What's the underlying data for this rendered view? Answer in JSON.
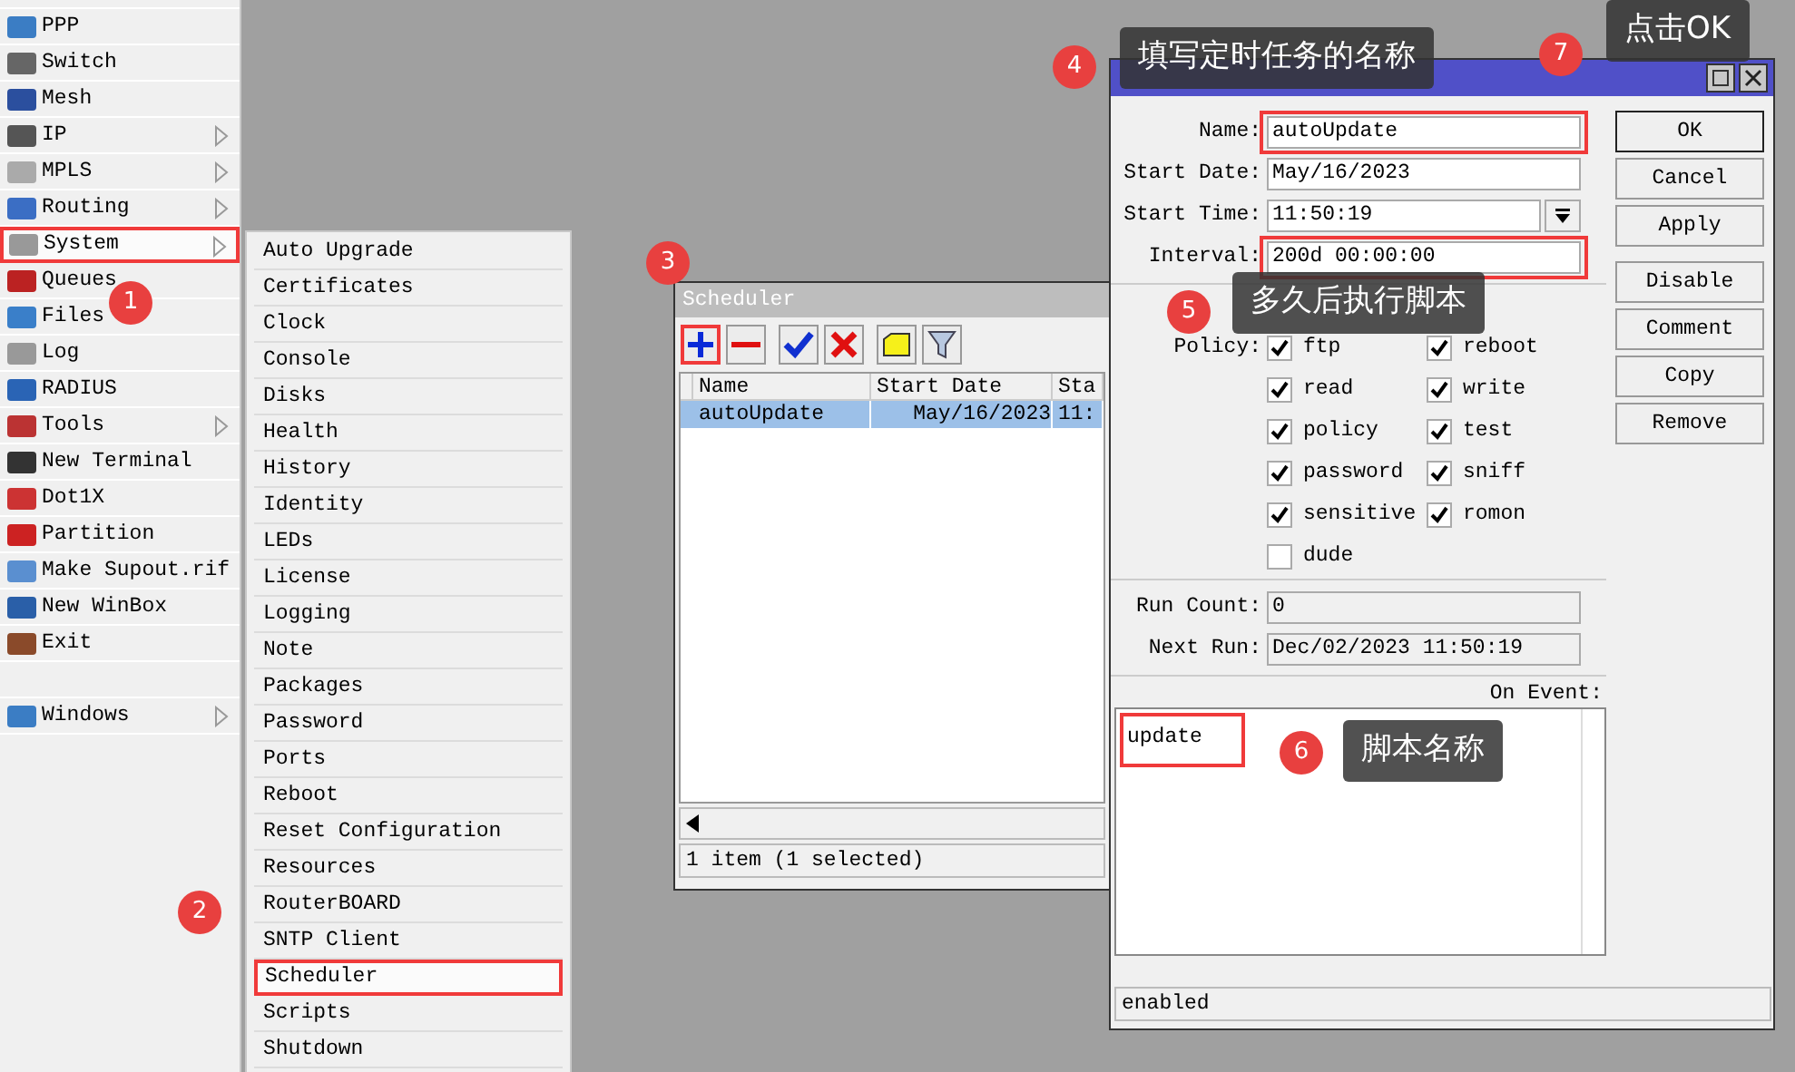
{
  "main_menu": {
    "items": [
      {
        "label": "PPP",
        "has_submenu": false,
        "selected": false,
        "highlighted": false
      },
      {
        "label": "Switch",
        "has_submenu": false,
        "selected": false,
        "highlighted": false
      },
      {
        "label": "Mesh",
        "has_submenu": false,
        "selected": false,
        "highlighted": false
      },
      {
        "label": "IP",
        "has_submenu": true,
        "selected": false,
        "highlighted": false
      },
      {
        "label": "MPLS",
        "has_submenu": true,
        "selected": false,
        "highlighted": false
      },
      {
        "label": "Routing",
        "has_submenu": true,
        "selected": false,
        "highlighted": false
      },
      {
        "label": "System",
        "has_submenu": true,
        "selected": true,
        "highlighted": true
      },
      {
        "label": "Queues",
        "has_submenu": false,
        "selected": false,
        "highlighted": false
      },
      {
        "label": "Files",
        "has_submenu": false,
        "selected": false,
        "highlighted": false
      },
      {
        "label": "Log",
        "has_submenu": false,
        "selected": false,
        "highlighted": false
      },
      {
        "label": "RADIUS",
        "has_submenu": false,
        "selected": false,
        "highlighted": false
      },
      {
        "label": "Tools",
        "has_submenu": true,
        "selected": false,
        "highlighted": false
      },
      {
        "label": "New Terminal",
        "has_submenu": false,
        "selected": false,
        "highlighted": false
      },
      {
        "label": "Dot1X",
        "has_submenu": false,
        "selected": false,
        "highlighted": false
      },
      {
        "label": "Partition",
        "has_submenu": false,
        "selected": false,
        "highlighted": false
      },
      {
        "label": "Make Supout.rif",
        "has_submenu": false,
        "selected": false,
        "highlighted": false
      },
      {
        "label": "New WinBox",
        "has_submenu": false,
        "selected": false,
        "highlighted": false
      },
      {
        "label": "Exit",
        "has_submenu": false,
        "selected": false,
        "highlighted": false
      }
    ],
    "bottom_items": [
      {
        "label": "Windows",
        "has_submenu": true,
        "selected": false,
        "highlighted": false
      }
    ]
  },
  "system_submenu": {
    "items": [
      {
        "label": "Auto Upgrade",
        "selected": false,
        "highlighted": false
      },
      {
        "label": "Certificates",
        "selected": false,
        "highlighted": false
      },
      {
        "label": "Clock",
        "selected": false,
        "highlighted": false
      },
      {
        "label": "Console",
        "selected": false,
        "highlighted": false
      },
      {
        "label": "Disks",
        "selected": false,
        "highlighted": false
      },
      {
        "label": "Health",
        "selected": false,
        "highlighted": false
      },
      {
        "label": "History",
        "selected": false,
        "highlighted": false
      },
      {
        "label": "Identity",
        "selected": false,
        "highlighted": false
      },
      {
        "label": "LEDs",
        "selected": false,
        "highlighted": false
      },
      {
        "label": "License",
        "selected": false,
        "highlighted": false
      },
      {
        "label": "Logging",
        "selected": false,
        "highlighted": false
      },
      {
        "label": "Note",
        "selected": false,
        "highlighted": false
      },
      {
        "label": "Packages",
        "selected": false,
        "highlighted": false
      },
      {
        "label": "Password",
        "selected": false,
        "highlighted": false
      },
      {
        "label": "Ports",
        "selected": false,
        "highlighted": false
      },
      {
        "label": "Reboot",
        "selected": false,
        "highlighted": false
      },
      {
        "label": "Reset Configuration",
        "selected": false,
        "highlighted": false
      },
      {
        "label": "Resources",
        "selected": false,
        "highlighted": false
      },
      {
        "label": "RouterBOARD",
        "selected": false,
        "highlighted": false
      },
      {
        "label": "SNTP Client",
        "selected": false,
        "highlighted": false
      },
      {
        "label": "Scheduler",
        "selected": true,
        "highlighted": true
      },
      {
        "label": "Scripts",
        "selected": false,
        "highlighted": false
      },
      {
        "label": "Shutdown",
        "selected": false,
        "highlighted": false
      }
    ]
  },
  "scheduler_window": {
    "title": "Scheduler",
    "toolbar": [
      {
        "kind": "add",
        "highlighted": true
      },
      {
        "kind": "remove",
        "highlighted": false
      },
      {
        "kind": "enable",
        "highlighted": false
      },
      {
        "kind": "disable",
        "highlighted": false
      },
      {
        "kind": "comment",
        "highlighted": false
      },
      {
        "kind": "filter",
        "highlighted": false
      }
    ],
    "columns": [
      "Name",
      "Start Date",
      "Sta"
    ],
    "rows": [
      {
        "cells": [
          "autoUpdate",
          "May/16/2023",
          "11:"
        ],
        "selected": true
      }
    ],
    "status": "1 item (1 selected)"
  },
  "schedule_dialog": {
    "fields": [
      {
        "label": "Name:",
        "value": "autoUpdate",
        "dropdown": false,
        "highlighted": true
      },
      {
        "label": "Start Date:",
        "value": "May/16/2023",
        "dropdown": false,
        "highlighted": false
      },
      {
        "label": "Start Time:",
        "value": "11:50:19",
        "dropdown": true,
        "highlighted": false
      },
      {
        "label": "Interval:",
        "value": "200d 00:00:00",
        "dropdown": false,
        "highlighted": true
      }
    ],
    "policy_label": "Policy:",
    "policies": [
      {
        "label": "ftp",
        "checked": true
      },
      {
        "label": "reboot",
        "checked": true
      },
      {
        "label": "read",
        "checked": true
      },
      {
        "label": "write",
        "checked": true
      },
      {
        "label": "policy",
        "checked": true
      },
      {
        "label": "test",
        "checked": true
      },
      {
        "label": "password",
        "checked": true
      },
      {
        "label": "sniff",
        "checked": true
      },
      {
        "label": "sensitive",
        "checked": true
      },
      {
        "label": "romon",
        "checked": true
      },
      {
        "label": "dude",
        "checked": false
      }
    ],
    "readonly_fields": [
      {
        "label": "Run Count:",
        "value": "0"
      },
      {
        "label": "Next Run:",
        "value": "Dec/02/2023 11:50:19"
      }
    ],
    "on_event": {
      "label": "On Event:",
      "script": "update",
      "highlighted": true
    },
    "buttons": [
      {
        "label": "OK",
        "default": true
      },
      {
        "label": "Cancel",
        "default": false
      },
      {
        "label": "Apply",
        "default": false
      },
      {
        "label": "Disable",
        "default": false
      },
      {
        "label": "Comment",
        "default": false
      },
      {
        "label": "Copy",
        "default": false
      },
      {
        "label": "Remove",
        "default": false
      }
    ],
    "status": "enabled"
  },
  "callouts": [
    {
      "number": "1"
    },
    {
      "number": "2"
    },
    {
      "number": "3"
    },
    {
      "number": "4",
      "text": "填写定时任务的名称"
    },
    {
      "number": "5",
      "text": "多久后执行脚本"
    },
    {
      "number": "6",
      "text": "脚本名称"
    },
    {
      "number": "7",
      "text": "点击OK"
    }
  ]
}
